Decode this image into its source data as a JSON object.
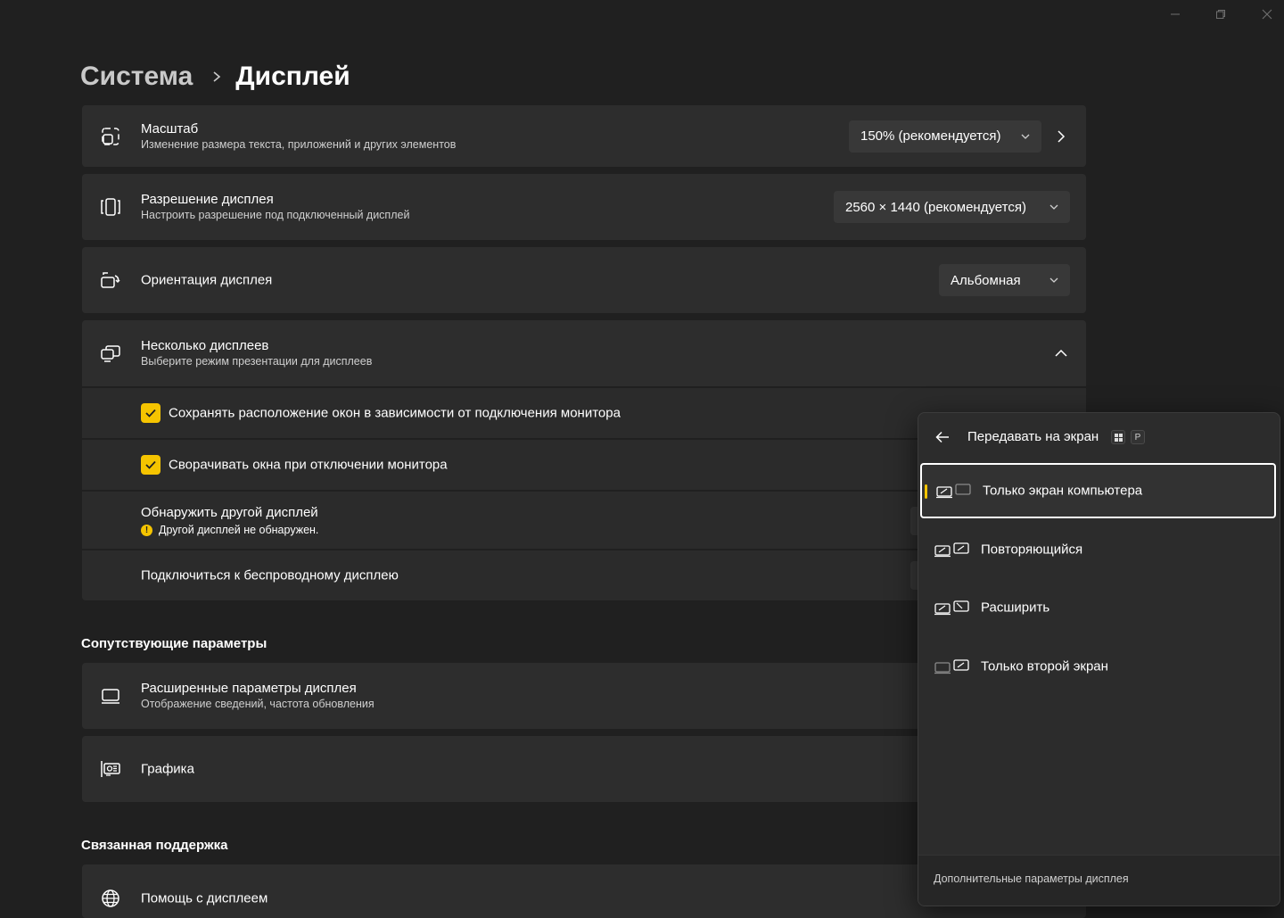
{
  "window": {
    "minimize_icon": "minimize-icon",
    "maximize_icon": "restore-icon",
    "close_icon": "close-icon"
  },
  "breadcrumb": {
    "parent": "Система",
    "current": "Дисплей"
  },
  "settings": {
    "scale": {
      "title": "Масштаб",
      "subtitle": "Изменение размера текста, приложений и других элементов",
      "value": "150% (рекомендуется)",
      "icon": "scale-icon"
    },
    "resolution": {
      "title": "Разрешение дисплея",
      "subtitle": "Настроить разрешение под подключенный дисплей",
      "value": "2560 × 1440 (рекомендуется)",
      "icon": "resolution-icon"
    },
    "orientation": {
      "title": "Ориентация дисплея",
      "value": "Альбомная",
      "icon": "orientation-icon"
    },
    "multiple": {
      "title": "Несколько дисплеев",
      "subtitle": "Выберите режим презентации для дисплеев",
      "icon": "multiple-displays-icon",
      "options": {
        "remember": "Сохранять расположение окон в зависимости от подключения монитора",
        "minimize": "Сворачивать окна при отключении монитора",
        "detect_title": "Обнаружить другой дисплей",
        "detect_status": "Другой дисплей не обнаружен.",
        "wireless": "Подключиться к беспроводному дисплею"
      }
    }
  },
  "related": {
    "heading": "Сопутствующие параметры",
    "advanced": {
      "title": "Расширенные параметры дисплея",
      "subtitle": "Отображение сведений, частота обновления",
      "icon": "monitor-icon"
    },
    "graphics": {
      "title": "Графика",
      "icon": "graphics-card-icon"
    }
  },
  "support": {
    "heading": "Связанная поддержка",
    "help": {
      "title": "Помощь с дисплеем",
      "icon": "globe-icon"
    }
  },
  "flyout": {
    "title": "Передавать на экран",
    "shortcut_key": "P",
    "options": [
      {
        "label": "Только экран компьютера",
        "selected": true
      },
      {
        "label": "Повторяющийся",
        "selected": false
      },
      {
        "label": "Расширить",
        "selected": false
      },
      {
        "label": "Только второй экран",
        "selected": false
      }
    ],
    "footer": "Дополнительные параметры дисплея"
  },
  "colors": {
    "accent": "#f5c400",
    "background": "#202020",
    "card": "#2d2d2d"
  }
}
